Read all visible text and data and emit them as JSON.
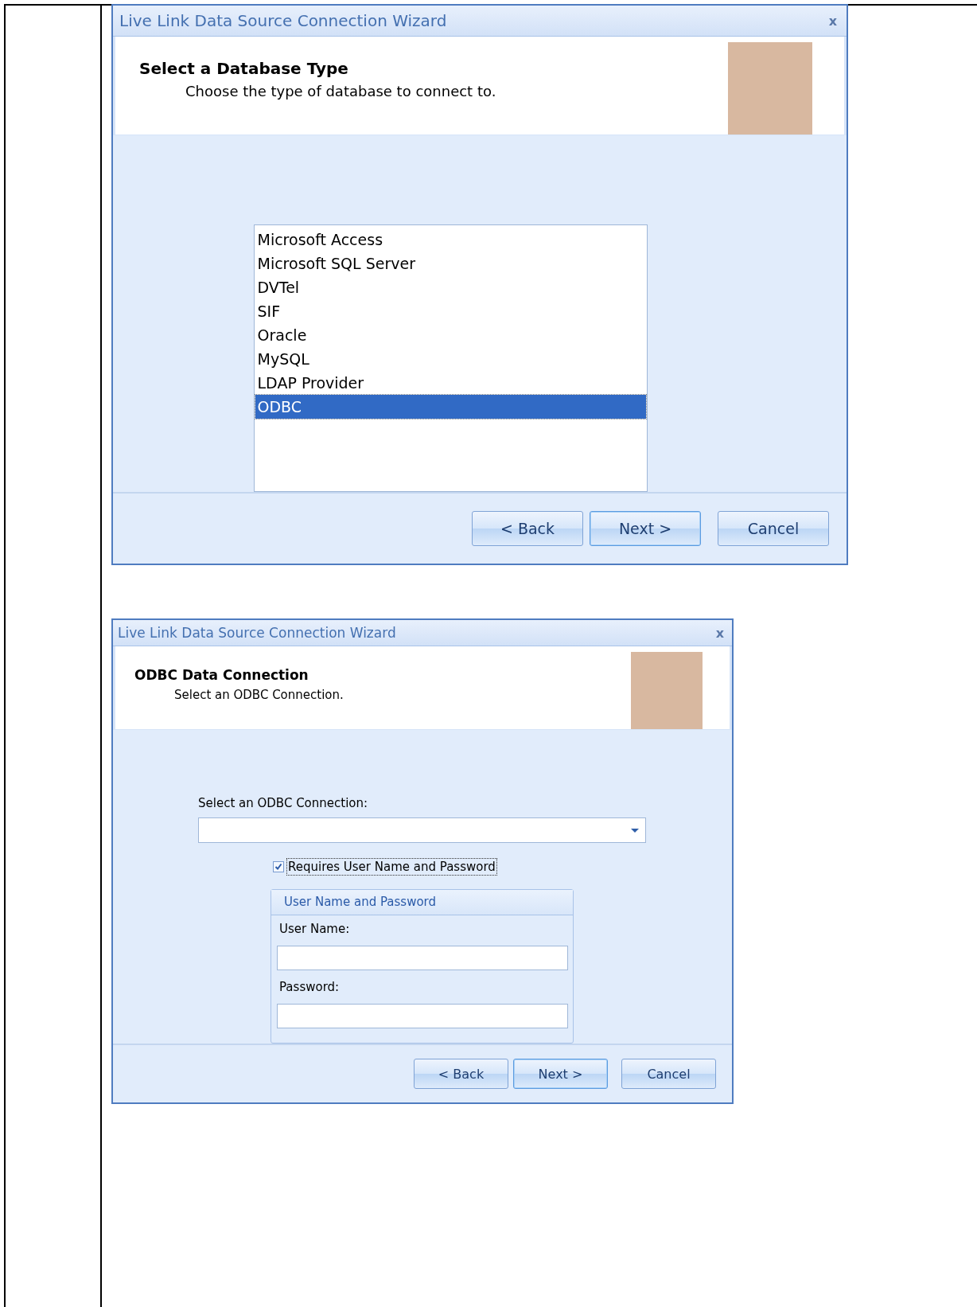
{
  "dialogs": [
    {
      "title": "Live Link Data Source Connection Wizard",
      "close": "x",
      "heading": "Select a Database Type",
      "subheading": "Choose the type of database to connect to.",
      "body": {
        "kind": "list",
        "items": [
          {
            "label": "Microsoft Access",
            "selected": false
          },
          {
            "label": "Microsoft SQL Server",
            "selected": false
          },
          {
            "label": "DVTel",
            "selected": false
          },
          {
            "label": "SIF",
            "selected": false
          },
          {
            "label": "Oracle",
            "selected": false
          },
          {
            "label": "MySQL",
            "selected": false
          },
          {
            "label": "LDAP Provider",
            "selected": false
          },
          {
            "label": "ODBC",
            "selected": true
          }
        ]
      },
      "buttons": [
        {
          "label": "< Back",
          "default": false
        },
        {
          "label": "Next >",
          "default": true
        },
        {
          "label": "Cancel",
          "default": false
        }
      ]
    },
    {
      "title": "Live Link Data Source Connection Wizard",
      "close": "x",
      "heading": "ODBC Data Connection",
      "subheading": "Select an ODBC Connection.",
      "body": {
        "kind": "form",
        "combo_label": "Select an ODBC Connection:",
        "checkbox": {
          "label": "Requires User Name and Password",
          "checked": true,
          "focused": true
        },
        "group": {
          "title": "User Name and Password",
          "fields": [
            {
              "label": "User Name:"
            },
            {
              "label": "Password:"
            }
          ]
        }
      },
      "buttons": [
        {
          "label": "< Back",
          "default": false
        },
        {
          "label": "Next >",
          "default": true
        },
        {
          "label": "Cancel",
          "default": false
        }
      ]
    }
  ]
}
